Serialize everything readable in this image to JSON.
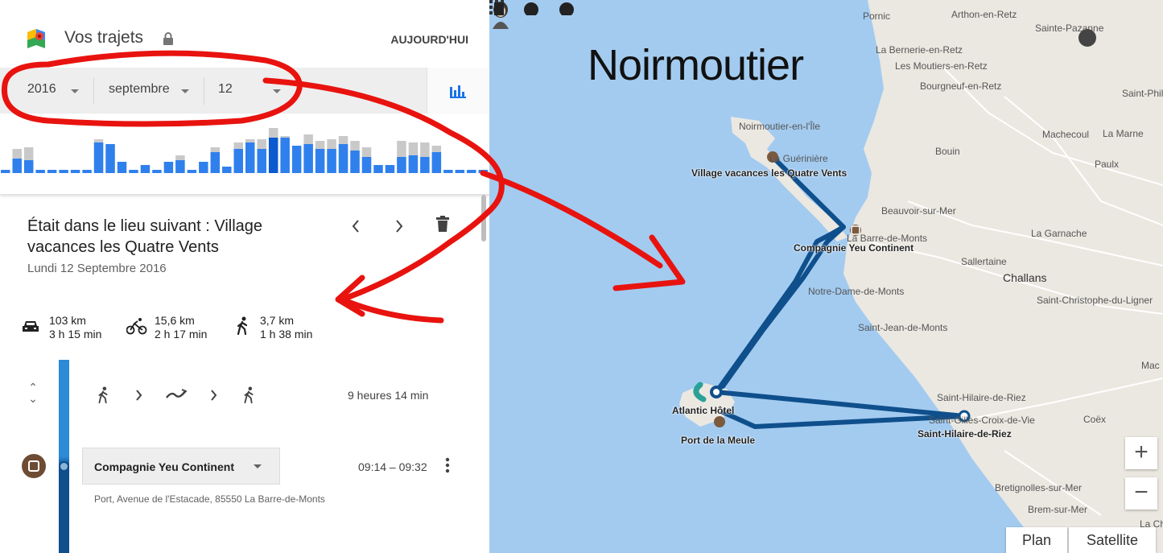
{
  "app": {
    "title": "Vos trajets",
    "today": "AUJOURD'HUI"
  },
  "date_filter": {
    "year": "2016",
    "month": "septembre",
    "day": "12"
  },
  "histogram": {
    "bars_gray": [
      0,
      18,
      20,
      0,
      0,
      0,
      0,
      0,
      30,
      22,
      0,
      0,
      0,
      0,
      0,
      10,
      0,
      0,
      20,
      0,
      26,
      30,
      30,
      44,
      34,
      0,
      36,
      28,
      30,
      34,
      28,
      20,
      0,
      0,
      28,
      26,
      26,
      22,
      0,
      0,
      0,
      0
    ],
    "bars_blue": [
      4,
      18,
      16,
      4,
      4,
      4,
      4,
      4,
      38,
      36,
      14,
      4,
      10,
      4,
      14,
      16,
      4,
      14,
      26,
      8,
      30,
      38,
      30,
      44,
      44,
      34,
      36,
      30,
      30,
      36,
      28,
      20,
      10,
      10,
      20,
      22,
      20,
      26,
      4,
      4,
      4,
      4
    ],
    "highlight_index": 23
  },
  "place": {
    "title": "Était dans le lieu suivant : Village vacances les Quatre Vents",
    "date": "Lundi 12 Septembre 2016"
  },
  "stats": {
    "car": {
      "distance": "103 km",
      "duration": "3 h 15 min"
    },
    "bike": {
      "distance": "15,6 km",
      "duration": "2 h 17 min"
    },
    "walk": {
      "distance": "3,7 km",
      "duration": "1 h 38 min"
    }
  },
  "segment": {
    "duration": "9 heures 14 min"
  },
  "stop": {
    "name": "Compagnie Yeu Continent",
    "time": "09:14 – 09:32",
    "address": "Port, Avenue de l'Estacade, 85550 La Barre-de-Monts"
  },
  "map": {
    "heading": "Noirmoutier",
    "zoom_in": "+",
    "zoom_out": "−",
    "type_plan": "Plan",
    "type_satellite": "Satellite",
    "labels": {
      "pornic": "Pornic",
      "arthon": "Arthon-en-Retz",
      "sainte_pazanne": "Sainte-Pazanne",
      "bernerie": "La Bernerie-en-Retz",
      "moutiers": "Les Moutiers-en-Retz",
      "bourgneuf": "Bourgneuf-en-Retz",
      "saint_phil": "Saint-Phil",
      "noirmoutier_ile": "Noirmoutier-en-l'Île",
      "gueriniere": "La Guérinière",
      "village": "Village vacances les Quatre Vents",
      "machecoul": "Machecoul",
      "la_marne": "La Marne",
      "bouin": "Bouin",
      "paulx": "Paulx",
      "beauvoir": "Beauvoir-sur-Mer",
      "barre": "La Barre-de-Monts",
      "compagnie": "Compagnie Yeu Continent",
      "garnache": "La Garnache",
      "sallertaine": "Sallertaine",
      "challans": "Challans",
      "notre_dame": "Notre-Dame-de-Monts",
      "saint_christophe": "Saint-Christophe-du-Ligner",
      "saint_jean": "Saint-Jean-de-Monts",
      "mac": "Mac",
      "saint_hilaire_top": "Saint-Hilaire-de-Riez",
      "atlantic": "Atlantic Hôtel",
      "croix_de_vie": "Saint-Gilles-Croix-de-Vie",
      "coex": "Coëx",
      "saint_hilaire_bold": "Saint-Hilaire-de-Riez",
      "port_meule": "Port de la Meule",
      "bretignolles": "Bretignolles-sur-Mer",
      "brem": "Brem-sur-Mer",
      "la_cha": "La Cha"
    }
  },
  "colors": {
    "route": "#0f4f8c",
    "water": "#a3cbf0",
    "land": "#ebe8e1",
    "annotation": "#e8130f",
    "hist_blue": "#2f80ed",
    "hist_gray": "#c9c9c9",
    "marker": "#6d4c33"
  },
  "icons": {
    "logo": "google-maps-icon",
    "lock": "lock-icon",
    "stats": "bar-chart-icon",
    "prev": "chevron-left-icon",
    "next": "chevron-right-icon",
    "delete": "trash-icon",
    "car": "car-icon",
    "bike": "bike-icon",
    "walk": "walk-icon",
    "boat": "boat-icon",
    "more": "more-vert-icon"
  }
}
